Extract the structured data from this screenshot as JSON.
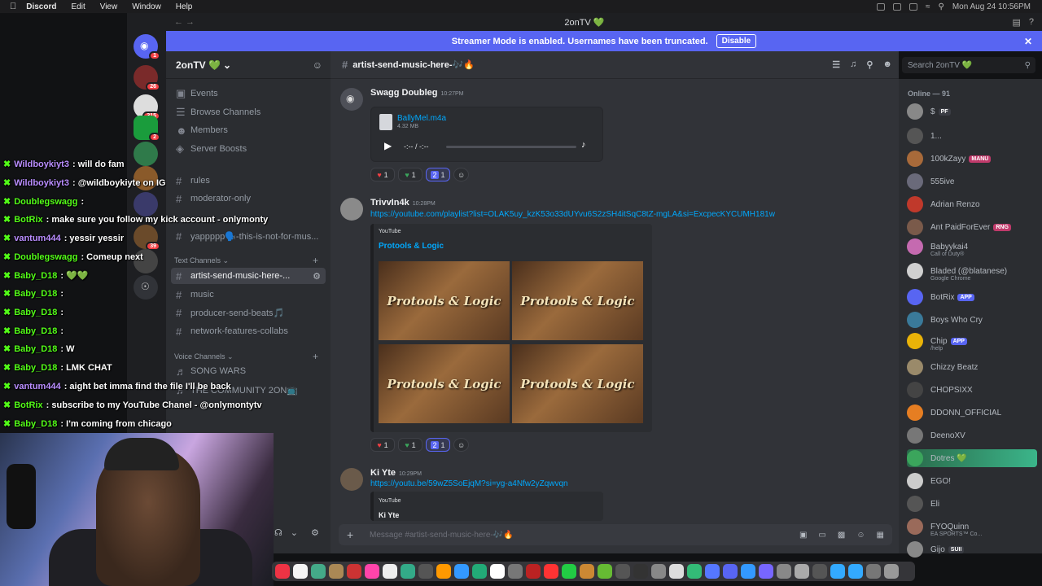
{
  "menubar": {
    "app": "Discord",
    "items": [
      "Edit",
      "View",
      "Window",
      "Help"
    ],
    "datetime": "Mon Aug 24  10:56PM"
  },
  "window": {
    "title": "2onTV 💚"
  },
  "banner": {
    "text": "Streamer Mode is enabled. Usernames have been truncated.",
    "button": "Disable"
  },
  "rail_badges": [
    "1",
    "26",
    "315",
    "2",
    "39"
  ],
  "server": {
    "name": "2onTV 💚",
    "top_items": [
      "Events",
      "Browse Channels",
      "Members",
      "Server Boosts"
    ],
    "channels_top": [
      "rules",
      "moderator-only",
      "yappppp🗣️-this-is-not-for-mus..."
    ],
    "text_category": "Text Channels",
    "text_channels": [
      "artist-send-music-here-...",
      "music",
      "producer-send-beats🎵",
      "network-features-collabs"
    ],
    "voice_category": "Voice Channels",
    "voice_channels": [
      "SONG WARS",
      "THE COMMUNITY 2ON📺"
    ]
  },
  "chat": {
    "channel": "artist-send-music-here-🎶🔥",
    "search_placeholder": "Search 2onTV 💚",
    "messages": [
      {
        "author": "Swagg Doubleg",
        "time": "10:27PM",
        "file_name": "BallyMel.m4a",
        "file_size": "4.32 MB",
        "audio_time": "-:-- / -:--",
        "reactions": [
          {
            "emoji": "❤️",
            "count": "1"
          },
          {
            "emoji": "💚",
            "count": "1"
          },
          {
            "emoji": "2",
            "count": "1"
          }
        ]
      },
      {
        "author": "TrivvIn4k",
        "time": "10:28PM",
        "link": "https://youtube.com/playlist?list=OLAK5uy_kzK53o33dUYvu6S2zSH4itSqC8tZ-mgLA&si=ExcpecKYCUMH181w",
        "embed_provider": "YouTube",
        "embed_title": "Protools & Logic",
        "thumb_text": "Protools & Logic",
        "reactions": [
          {
            "emoji": "❤️",
            "count": "1"
          },
          {
            "emoji": "💚",
            "count": "1"
          },
          {
            "emoji": "2",
            "count": "1"
          }
        ]
      },
      {
        "author": "Ki Yte",
        "time": "10:29PM",
        "link": "https://youtu.be/59wZ5SoEjqM?si=yg-a4Nfw2yZqwvqn",
        "embed_provider": "YouTube",
        "embed_title": "Ki Yte"
      }
    ],
    "composer_placeholder": "Message #artist-send-music-here-🎶🔥"
  },
  "members": {
    "header": "Online — 91",
    "list": [
      {
        "name": "$",
        "tag": "PF",
        "sub": ""
      },
      {
        "name": "1...",
        "tag": "",
        "sub": ""
      },
      {
        "name": "100kZayy",
        "tag": "MANU",
        "sub": ""
      },
      {
        "name": "555ive",
        "tag": "",
        "sub": ""
      },
      {
        "name": "Adrian Renzo",
        "tag": "",
        "sub": ""
      },
      {
        "name": "Ant PaidForEver",
        "tag": "RNG",
        "sub": ""
      },
      {
        "name": "Babyykai4",
        "tag": "",
        "sub": "Call of Duty®"
      },
      {
        "name": "Bladed (@blatanese)",
        "tag": "",
        "sub": "Google Chrome"
      },
      {
        "name": "BotRix",
        "tag": "APP",
        "sub": ""
      },
      {
        "name": "Boys Who Cry",
        "tag": "",
        "sub": ""
      },
      {
        "name": "Chip",
        "tag": "APP",
        "sub": "/help"
      },
      {
        "name": "Chizzy Beatz",
        "tag": "",
        "sub": ""
      },
      {
        "name": "CHOPSIXX",
        "tag": "",
        "sub": ""
      },
      {
        "name": "DDONN_OFFICIAL",
        "tag": "",
        "sub": ""
      },
      {
        "name": "DeenoXV",
        "tag": "",
        "sub": ""
      },
      {
        "name": "Dotres 💚",
        "tag": "",
        "sub": ""
      },
      {
        "name": "EGO!",
        "tag": "",
        "sub": ""
      },
      {
        "name": "Eli",
        "tag": "",
        "sub": ""
      },
      {
        "name": "FYOQuinn",
        "tag": "",
        "sub": "EA SPORTS™ Co..."
      },
      {
        "name": "Gijo",
        "tag": "SUII",
        "sub": ""
      }
    ]
  },
  "stream_chat": [
    {
      "user": "Wildboykiyt3",
      "msg": ": will do fam",
      "color": "purple"
    },
    {
      "user": "Wildboykiyt3",
      "msg": ": @wildboykiyte on IG",
      "color": "purple"
    },
    {
      "user": "Doublegswagg",
      "msg": ":",
      "color": "green"
    },
    {
      "user": "BotRix",
      "msg": ": make sure you follow my kick account - onlymonty",
      "color": "green"
    },
    {
      "user": "vantum444",
      "msg": ": yessir yessir",
      "color": "purple"
    },
    {
      "user": "Doublegswagg",
      "msg": ": Comeup next",
      "color": "green"
    },
    {
      "user": "Baby_D18",
      "msg": ": 💚💚",
      "color": "green"
    },
    {
      "user": "Baby_D18",
      "msg": ":",
      "color": "green"
    },
    {
      "user": "Baby_D18",
      "msg": ":",
      "color": "green"
    },
    {
      "user": "Baby_D18",
      "msg": ":",
      "color": "green"
    },
    {
      "user": "Baby_D18",
      "msg": ": W",
      "color": "green"
    },
    {
      "user": "Baby_D18",
      "msg": ": LMK CHAT",
      "color": "green"
    },
    {
      "user": "vantum444",
      "msg": ": aight bet imma find the file I'll be back",
      "color": "purple"
    },
    {
      "user": "BotRix",
      "msg": ": subscribe to my YouTube Chanel - @onlymontytv",
      "color": "green"
    },
    {
      "user": "Baby_D18",
      "msg": ": I'm coming from chicago",
      "color": "green"
    }
  ]
}
